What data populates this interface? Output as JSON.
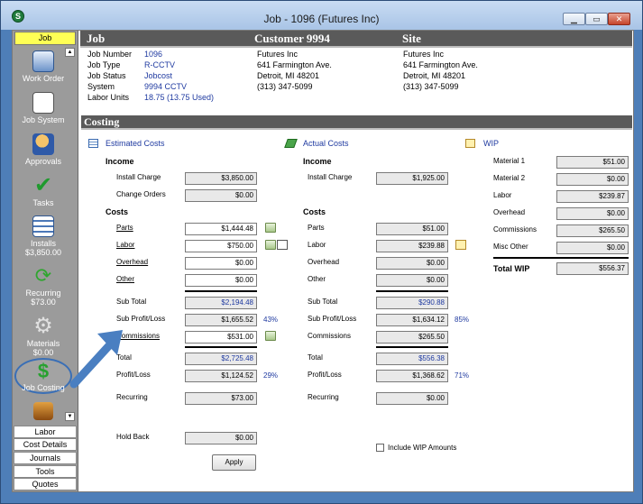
{
  "window": {
    "title": "Job - 1096 (Futures  Inc)",
    "app_logo": "S"
  },
  "sidebar": {
    "header": "Job",
    "items": [
      {
        "label": "Work Order",
        "sub": "",
        "icon": "work-order-icon"
      },
      {
        "label": "Job System",
        "sub": "",
        "icon": "job-system-icon"
      },
      {
        "label": "Approvals",
        "sub": "",
        "icon": "approvals-icon"
      },
      {
        "label": "Tasks",
        "sub": "",
        "icon": "checkmark-icon"
      },
      {
        "label": "Installs",
        "sub": "$3,850.00",
        "icon": "installs-icon"
      },
      {
        "label": "Recurring",
        "sub": "$73.00",
        "icon": "recurring-icon"
      },
      {
        "label": "Materials",
        "sub": "$0.00",
        "icon": "gear-icon"
      },
      {
        "label": "Job Costing",
        "sub": "",
        "icon": "dollar-icon"
      }
    ],
    "footer": [
      "Labor",
      "Cost Details",
      "Journals",
      "Tools",
      "Quotes"
    ]
  },
  "header": {
    "job_label": "Job",
    "customer_label": "Customer 9994",
    "site_label": "Site",
    "fields": [
      {
        "label": "Job Number",
        "value": "1096"
      },
      {
        "label": "Job Type",
        "value": "R-CCTV"
      },
      {
        "label": "Job Status",
        "value": "Jobcost"
      },
      {
        "label": "System",
        "value": "9994 CCTV"
      },
      {
        "label": "Labor Units",
        "value": "18.75 (13.75 Used)"
      }
    ],
    "customer": [
      "Futures  Inc",
      "641 Farmington Ave.",
      "Detroit, MI 48201",
      "(313) 347-5099"
    ],
    "site": [
      "Futures  Inc",
      "641 Farmington Ave.",
      "Detroit, MI 48201",
      "(313) 347-5099"
    ]
  },
  "costing": {
    "title": "Costing",
    "estimated": {
      "heading": "Estimated Costs",
      "income_label": "Income",
      "install_charge_label": "Install Charge",
      "install_charge": "$3,850.00",
      "change_orders_label": "Change Orders",
      "change_orders": "$0.00",
      "costs_label": "Costs",
      "parts_label": "Parts",
      "parts": "$1,444.48",
      "labor_label": "Labor",
      "labor": "$750.00",
      "overhead_label": "Overhead",
      "overhead": "$0.00",
      "other_label": "Other",
      "other": "$0.00",
      "subtotal_label": "Sub Total",
      "subtotal": "$2,194.48",
      "sub_pl_label": "Sub Profit/Loss",
      "sub_pl": "$1,655.52",
      "sub_pl_pct": "43%",
      "commissions_label": "Commissions",
      "commissions": "$531.00",
      "total_label": "Total",
      "total": "$2,725.48",
      "pl_label": "Profit/Loss",
      "pl": "$1,124.52",
      "pl_pct": "29%",
      "recurring_label": "Recurring",
      "recurring": "$73.00",
      "holdback_label": "Hold Back",
      "holdback": "$0.00",
      "apply_label": "Apply"
    },
    "actual": {
      "heading": "Actual Costs",
      "income_label": "Income",
      "install_charge_label": "Install Charge",
      "install_charge": "$1,925.00",
      "costs_label": "Costs",
      "parts_label": "Parts",
      "parts": "$51.00",
      "labor_label": "Labor",
      "labor": "$239.88",
      "overhead_label": "Overhead",
      "overhead": "$0.00",
      "other_label": "Other",
      "other": "$0.00",
      "subtotal_label": "Sub Total",
      "subtotal": "$290.88",
      "sub_pl_label": "Sub Profit/Loss",
      "sub_pl": "$1,634.12",
      "sub_pl_pct": "85%",
      "commissions_label": "Commissions",
      "commissions": "$265.50",
      "total_label": "Total",
      "total": "$556.38",
      "pl_label": "Profit/Loss",
      "pl": "$1,368.62",
      "pl_pct": "71%",
      "recurring_label": "Recurring",
      "recurring": "$0.00",
      "include_wip_label": "Include WIP Amounts"
    },
    "wip": {
      "heading": "WIP",
      "material1_label": "Material 1",
      "material1": "$51.00",
      "material2_label": "Material 2",
      "material2": "$0.00",
      "labor_label": "Labor",
      "labor": "$239.87",
      "overhead_label": "Overhead",
      "overhead": "$0.00",
      "commissions_label": "Commissions",
      "commissions": "$265.50",
      "misc_label": "Misc Other",
      "misc": "$0.00",
      "total_label": "Total WIP",
      "total": "$556.37"
    }
  },
  "colors": {
    "accent_blue": "#1f3aa0",
    "header_gray": "#5a5a5a",
    "highlight_yellow": "#ffff55",
    "callout_blue": "#4a7fc1"
  }
}
